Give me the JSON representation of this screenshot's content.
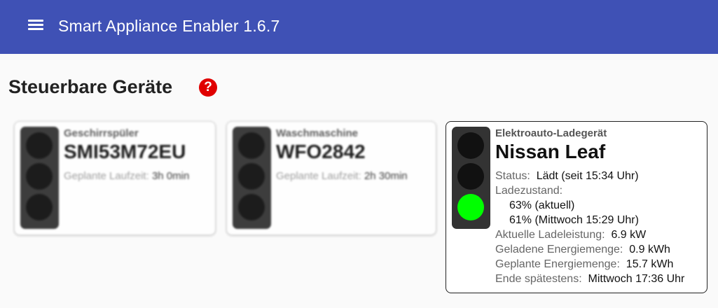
{
  "header": {
    "title": "Smart Appliance Enabler 1.6.7",
    "menu_icon": "hamburger-menu-icon",
    "background": "#3f51b5"
  },
  "page": {
    "title": "Steuerbare Geräte",
    "help_icon": "?",
    "help_color": "#e00000"
  },
  "devices": [
    {
      "type": "Geschirrspüler",
      "name": "SMI53M72EU",
      "plan_label": "Geplante Laufzeit:",
      "plan_value": "3h 0min",
      "light": "off"
    },
    {
      "type": "Waschmaschine",
      "name": "WFO2842",
      "plan_label": "Geplante Laufzeit:",
      "plan_value": "2h 30min",
      "light": "off"
    },
    {
      "type": "Elektroauto-Ladegerät",
      "name": "Nissan Leaf",
      "light": "green",
      "light_color": "#00ff00",
      "status_label": "Status:",
      "status_value": "Lädt (seit 15:34 Uhr)",
      "soc_label": "Ladezustand:",
      "soc_current": "63% (aktuell)",
      "soc_planned": "61% (Mittwoch 15:29 Uhr)",
      "power_label": "Aktuelle Ladeleistung:",
      "power_value": "6.9 kW",
      "charged_label": "Geladene Energiemenge:",
      "charged_value": "0.9 kWh",
      "planned_label": "Geplante Energiemenge:",
      "planned_value": "15.7 kWh",
      "end_label": "Ende spätestens:",
      "end_value": "Mittwoch 17:36 Uhr"
    }
  ]
}
